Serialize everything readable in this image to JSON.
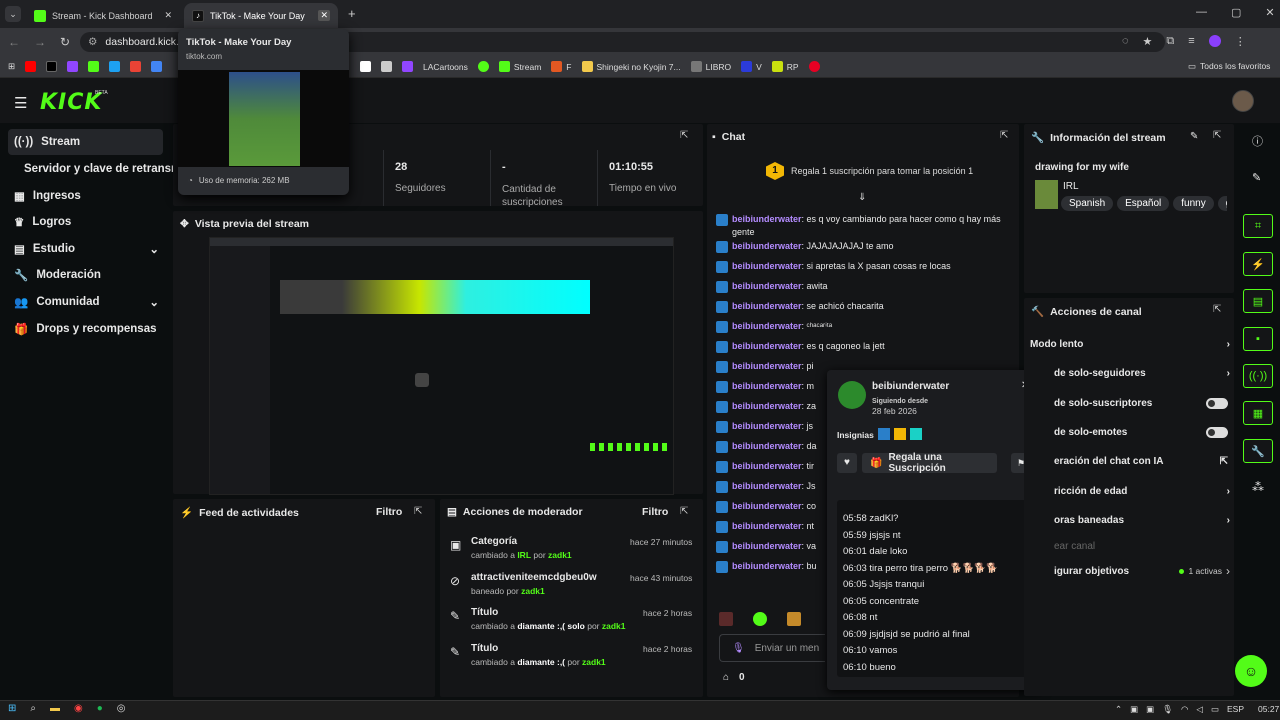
{
  "tabs": [
    {
      "label": "Stream - Kick Dashboard"
    },
    {
      "label": "TikTok - Make Your Day"
    }
  ],
  "address": "dashboard.kick.co",
  "bookmarks": {
    "items": [
      "LACartoons",
      "Stream",
      "F",
      "Shingeki no Kyojin 7...",
      "LIBRO",
      "V",
      "RP"
    ],
    "all": "Todos los favoritos"
  },
  "tooltip": {
    "title": "TikTok - Make Your Day",
    "url": "tiktok.com",
    "memory": "Uso de memoria: 262 MB"
  },
  "logo": "KICK",
  "beta": "BETA",
  "sidebar": {
    "items": [
      "Stream",
      "Servidor y clave de retransm",
      "Ingresos",
      "Logros",
      "Estudio",
      "Moderación",
      "Comunidad",
      "Drops y recompensas"
    ]
  },
  "stats": [
    {
      "value": "28",
      "label": "Seguidores"
    },
    {
      "value": "-",
      "label": "Cantidad de suscripciones"
    },
    {
      "value": "01:10:55",
      "label": "Tiempo en vivo"
    }
  ],
  "preview": {
    "title": "Vista previa del stream"
  },
  "activity": {
    "title": "Feed de actividades",
    "filter": "Filtro"
  },
  "modactions": {
    "title": "Acciones de moderador",
    "filter": "Filtro",
    "rows": [
      {
        "title": "Categoría",
        "pre": "cambiado a ",
        "target": "IRL",
        "mid": " por ",
        "by": "zadk1",
        "time": "hace 27 minutos"
      },
      {
        "title": "attractiveniteemcdgbeu0w",
        "pre": "baneado por ",
        "target": "",
        "mid": "",
        "by": "zadk1",
        "time": "hace 43 minutos"
      },
      {
        "title": "Título",
        "pre": "cambiado a ",
        "target": "diamante :,( solo",
        "mid": " por ",
        "by": "zadk1",
        "time": "hace 2 horas"
      },
      {
        "title": "Título",
        "pre": "cambiado a ",
        "target": "diamante :,(",
        "mid": " por ",
        "by": "zadk1",
        "time": "hace 2 horas"
      }
    ]
  },
  "chat": {
    "title": "Chat",
    "gift_banner": "Regala 1 suscripción para tomar la posición 1",
    "gift_rank": "1",
    "input_placeholder": "Enviar un men",
    "count": "0",
    "messages": [
      {
        "user": "beibiunderwater",
        "text": "es q voy cambiando para hacer como q hay más gente"
      },
      {
        "user": "beibiunderwater",
        "text": "JAJAJAJAJAJ te amo"
      },
      {
        "user": "beibiunderwater",
        "text": "si apretas la X pasan cosas re locas"
      },
      {
        "user": "beibiunderwater",
        "text": "awita"
      },
      {
        "user": "beibiunderwater",
        "text": "se achicó chacarita"
      },
      {
        "user": "beibiunderwater",
        "text": "ᶜʰᵃᶜᵃʳⁱᵗᵃ"
      },
      {
        "user": "beibiunderwater",
        "text": "es q cagoneo la jett"
      },
      {
        "user": "beibiunderwater",
        "text": "pi"
      },
      {
        "user": "beibiunderwater",
        "text": "m"
      },
      {
        "user": "beibiunderwater",
        "text": "za"
      },
      {
        "user": "beibiunderwater",
        "text": "js"
      },
      {
        "user": "beibiunderwater",
        "text": "da"
      },
      {
        "user": "beibiunderwater",
        "text": "tir"
      },
      {
        "user": "beibiunderwater",
        "text": "Js"
      },
      {
        "user": "beibiunderwater",
        "text": "co"
      },
      {
        "user": "beibiunderwater",
        "text": "nt"
      },
      {
        "user": "beibiunderwater",
        "text": "va"
      },
      {
        "user": "beibiunderwater",
        "text": "bu"
      }
    ]
  },
  "popup": {
    "user": "beibiunderwater",
    "following": "Siguiendo desde",
    "date": "28 feb 2026",
    "insignias": "Insignias",
    "gift": "Regala una Suscripción",
    "history": [
      "05:58 zadKl?",
      "05:59 jsjsjs nt",
      "06:01 dale loko",
      "06:03 tira perro tira perro 🐕🐕🐕🐕",
      "06:05 Jsjsjs tranqui",
      "06:05 concentrate",
      "06:08 nt",
      "06:09 jsjdjsjd se pudrió al final",
      "06:10 vamos",
      "06:10 bueno"
    ]
  },
  "info": {
    "title": "Información del stream",
    "stream_title": "drawing for my wife",
    "category": "IRL",
    "tags": [
      "Spanish",
      "Español",
      "funny",
      "ga"
    ]
  },
  "channel": {
    "title": "Acciones de canal",
    "rows": [
      "Modo lento",
      "de solo-seguidores",
      "de solo-suscriptores",
      "de solo-emotes",
      "eración del chat con IA",
      "ricción de edad",
      "oras baneadas",
      "ear canal",
      "igurar objetivos"
    ],
    "active": "1 activas"
  },
  "taskbar": {
    "lang": "ESP",
    "time": "05:27"
  }
}
